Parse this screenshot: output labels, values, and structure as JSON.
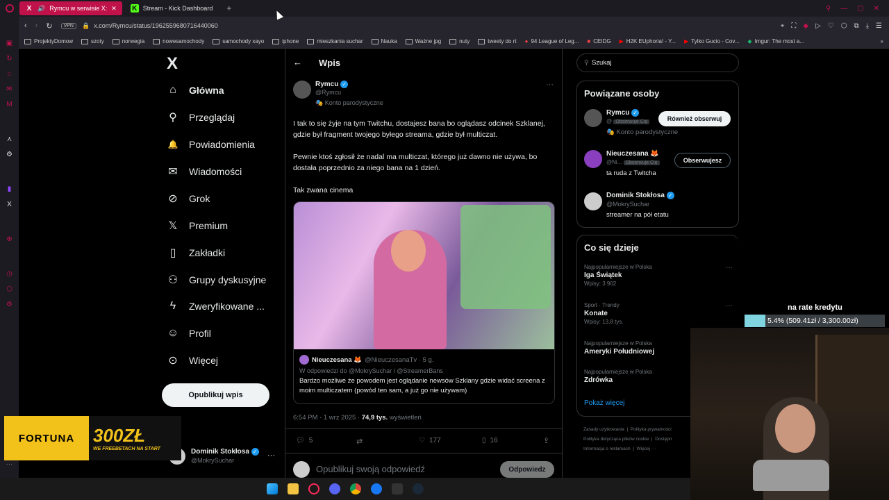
{
  "browser": {
    "tabs": [
      {
        "label": "Rymcu w serwisie X:",
        "active": true
      },
      {
        "label": "Stream - Kick Dashboard",
        "active": false
      }
    ],
    "new_tab": "+",
    "url": "x.com/Rymcu/status/1962559680716440060",
    "vpn": "VPN",
    "bookmarks": [
      "ProjektyDomow",
      "szoty",
      "norwegia",
      "nowesamochody",
      "samochody xayo",
      "iphone",
      "mieszkania suchar",
      "Nauka",
      "Ważne jpg",
      "nuty",
      "tweety do rt",
      "94 League of Leg...",
      "CEIDG",
      "H2K EUphoria! - Y...",
      "Tylko Gucio - Cov...",
      "Imgur: The most a..."
    ]
  },
  "nav": {
    "logo": "X",
    "items": [
      {
        "label": "Główna",
        "icon": "home-icon",
        "glyph": "⌂"
      },
      {
        "label": "Przeglądaj",
        "icon": "search-icon",
        "glyph": "⚲"
      },
      {
        "label": "Powiadomienia",
        "icon": "bell-icon",
        "glyph": "🔔"
      },
      {
        "label": "Wiadomości",
        "icon": "mail-icon",
        "glyph": "✉"
      },
      {
        "label": "Grok",
        "icon": "grok-icon",
        "glyph": "⊘"
      },
      {
        "label": "Premium",
        "icon": "x-premium-icon",
        "glyph": "𝕏"
      },
      {
        "label": "Zakładki",
        "icon": "bookmark-icon",
        "glyph": "▯"
      },
      {
        "label": "Grupy dyskusyjne",
        "icon": "communities-icon",
        "glyph": "⚇"
      },
      {
        "label": "Zweryfikowane ...",
        "icon": "lightning-icon",
        "glyph": "ϟ"
      },
      {
        "label": "Profil",
        "icon": "profile-icon",
        "glyph": "☺"
      },
      {
        "label": "Więcej",
        "icon": "more-circle-icon",
        "glyph": "⊙"
      }
    ],
    "post_button": "Opublikuj wpis",
    "account": {
      "name": "Dominik Stokłosa",
      "handle": "@MokrySuchar"
    }
  },
  "post": {
    "header": "Wpis",
    "author": {
      "name": "Rymcu",
      "handle": "@Rymcu",
      "tag": "Konto parodystyczne"
    },
    "paragraphs": [
      "I tak to się żyje na tym Twitchu, dostajesz bana bo oglądasz odcinek Szklanej, gdzie był fragment twojego byłego streama, gdzie był multiczat.",
      "Pewnie ktoś zgłosił że nadal ma multiczat, którego już dawno nie używa, bo dostała poprzednio za niego bana na 1 dzień.",
      "Tak zwana cinema"
    ],
    "quote": {
      "name": "Nieuczesana 🦊",
      "handle": "@NieuczesanaTv · 5 g.",
      "reply_to": "W odpowiedzi do @MokrySuchar i @StreamerBans",
      "text": "Bardzo możliwe że powodem jest oglądanie newsów Szklany gdzie widać screena z moim multiczatem (powód ten sam, a już go nie używam)"
    },
    "meta_time": "6:54 PM · 1 wrz 2025 · ",
    "meta_views": "74,9 tys.",
    "meta_views_label": " wyświetleń",
    "stats": {
      "replies": "5",
      "retweets": "",
      "likes": "177",
      "bookmarks": "16"
    },
    "reply_placeholder": "Opublikuj swoją odpowiedź",
    "reply_button": "Odpowiedz"
  },
  "right": {
    "search_placeholder": "Szukaj",
    "related_title": "Powiązane osoby",
    "related": [
      {
        "name": "Rymcu",
        "handle": "@",
        "follows_you": "Obserwuje Cię",
        "bio": "Konto parodystyczne",
        "button": "Również obserwuj"
      },
      {
        "name": "Nieuczesana 🦊",
        "handle": "@Ni...",
        "follows_you": "Obserwuje Cię",
        "bio": "ta ruda z Twitcha",
        "button": "Obserwujesz"
      },
      {
        "name": "Dominik Stokłosa",
        "handle": "@MokrySuchar",
        "bio": "streamer na pół etatu"
      }
    ],
    "trends_title": "Co się dzieje",
    "trends": [
      {
        "meta": "Najpopularniejsze w Polska",
        "name": "Iga Świątek",
        "sub": "Wpisy: 3 902"
      },
      {
        "meta": "Sport · Trendy",
        "name": "Konate",
        "sub": "Wpisy: 13,8 tys."
      },
      {
        "meta": "Najpopularniejsze w Polska",
        "name": "Ameryki Południowej",
        "sub": ""
      },
      {
        "meta": "Najpopularniejsze w Polska",
        "name": "Zdrówka",
        "sub": ""
      }
    ],
    "show_more": "Pokaż więcej",
    "footer": [
      "Zasady użytkowania",
      "Polityka prywatności",
      "Polityka dotycząca plików cookie",
      "Dostępn",
      "Informacja o reklamach",
      "Więcej ···"
    ]
  },
  "overlay": {
    "credit_label": "na rate kredytu",
    "credit_text": "5.4% (509.41zł / 3,300.00zł)",
    "credit_progress": 0.054,
    "ad_brand": "FORTUNA",
    "ad_amount": "300ZŁ",
    "ad_tag": "WE FREEBETACH NA START"
  },
  "colors": {
    "accent": "#1d9bf0",
    "tab_active": "#c0124a",
    "progress": "#7fd4e0",
    "ad_yellow": "#f2c21b"
  }
}
